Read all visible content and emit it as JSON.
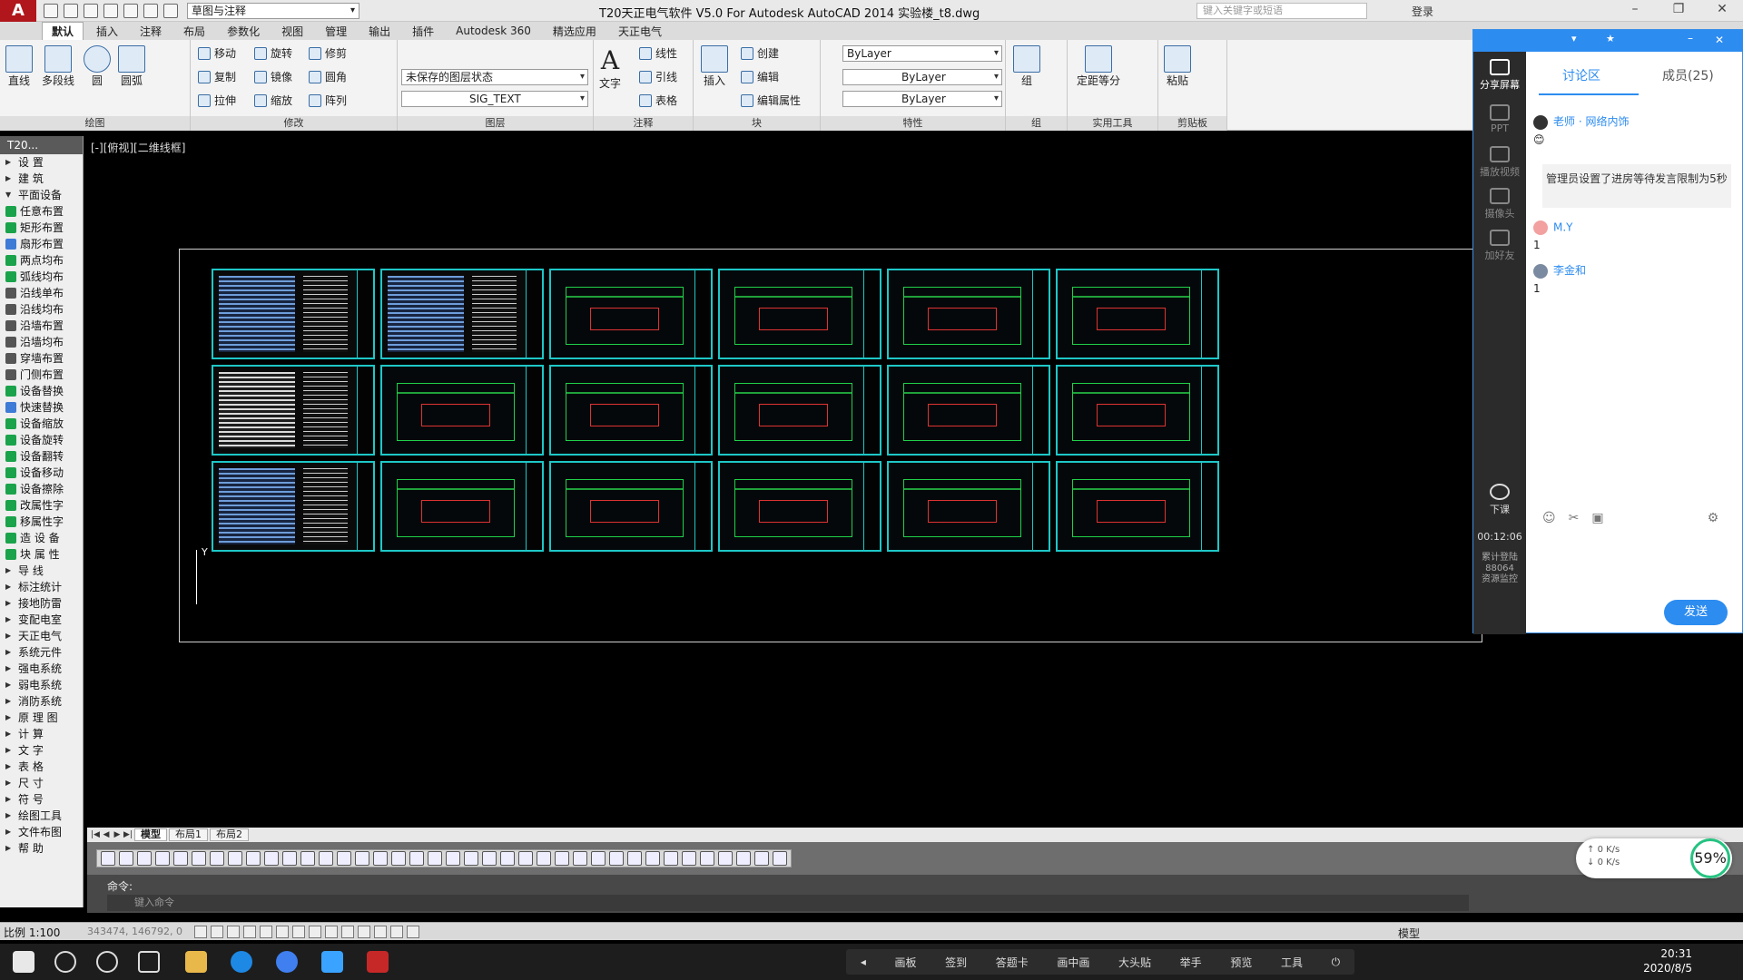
{
  "titlebar": {
    "workspace": "草图与注释",
    "title": "T20天正电气软件 V5.0 For Autodesk AutoCAD 2014    实验楼_t8.dwg",
    "search_placeholder": "键入关键字或短语",
    "login": "登录"
  },
  "ribbon": {
    "tabs": [
      "默认",
      "插入",
      "注释",
      "布局",
      "参数化",
      "视图",
      "管理",
      "输出",
      "插件",
      "Autodesk 360",
      "精选应用",
      "天正电气"
    ],
    "draw": {
      "title": "绘图",
      "line": "直线",
      "polyline": "多段线",
      "circle": "圆",
      "arc": "圆弧"
    },
    "modify": {
      "title": "修改",
      "move": "移动",
      "rotate": "旋转",
      "trim": "修剪",
      "copy": "复制",
      "mirror": "镜像",
      "fillet": "圆角",
      "stretch": "拉伸",
      "scale": "缩放",
      "array": "阵列"
    },
    "layers": {
      "title": "图层",
      "state": "未保存的图层状态",
      "current": "SIG_TEXT"
    },
    "annotation": {
      "title": "注释",
      "text": "文字",
      "linear": "线性",
      "leader": "引线",
      "table": "表格"
    },
    "block": {
      "title": "块",
      "insert": "插入",
      "create": "创建",
      "edit": "编辑",
      "attr": "编辑属性"
    },
    "properties": {
      "title": "特性",
      "color": "ByLayer",
      "linetype": "ByLayer",
      "lineweight": "ByLayer"
    },
    "group": {
      "title": "组",
      "group": "组"
    },
    "utilities": {
      "title": "实用工具",
      "measure": "定距等分"
    },
    "clipboard": {
      "title": "剪贴板",
      "paste": "粘贴"
    }
  },
  "t20": {
    "header": "T20...",
    "items": [
      {
        "label": "设    置",
        "type": "cat"
      },
      {
        "label": "建    筑",
        "type": "cat"
      },
      {
        "label": "平面设备",
        "type": "cat",
        "open": true
      },
      {
        "label": "任意布置",
        "type": "tool",
        "color": "#1aa34a"
      },
      {
        "label": "矩形布置",
        "type": "tool",
        "color": "#1aa34a"
      },
      {
        "label": "扇形布置",
        "type": "tool",
        "color": "#3d7bd6"
      },
      {
        "label": "两点均布",
        "type": "tool",
        "color": "#1aa34a"
      },
      {
        "label": "弧线均布",
        "type": "tool",
        "color": "#1aa34a"
      },
      {
        "label": "沿线单布",
        "type": "tool",
        "color": "#555"
      },
      {
        "label": "沿线均布",
        "type": "tool",
        "color": "#555"
      },
      {
        "label": "沿墙布置",
        "type": "tool",
        "color": "#555"
      },
      {
        "label": "沿墙均布",
        "type": "tool",
        "color": "#555"
      },
      {
        "label": "穿墙布置",
        "type": "tool",
        "color": "#555"
      },
      {
        "label": "门侧布置",
        "type": "tool",
        "color": "#555"
      },
      {
        "label": "设备替换",
        "type": "tool",
        "color": "#1aa34a"
      },
      {
        "label": "快速替换",
        "type": "tool",
        "color": "#3d7bd6"
      },
      {
        "label": "设备缩放",
        "type": "tool",
        "color": "#1aa34a"
      },
      {
        "label": "设备旋转",
        "type": "tool",
        "color": "#1aa34a"
      },
      {
        "label": "设备翻转",
        "type": "tool",
        "color": "#1aa34a"
      },
      {
        "label": "设备移动",
        "type": "tool",
        "color": "#1aa34a"
      },
      {
        "label": "设备擦除",
        "type": "tool",
        "color": "#1aa34a"
      },
      {
        "label": "改属性字",
        "type": "tool",
        "color": "#1aa34a"
      },
      {
        "label": "移属性字",
        "type": "tool",
        "color": "#1aa34a"
      },
      {
        "label": "造 设 备",
        "type": "tool",
        "color": "#1aa34a"
      },
      {
        "label": "块 属 性",
        "type": "tool",
        "color": "#1aa34a"
      },
      {
        "label": "导    线",
        "type": "cat"
      },
      {
        "label": "标注统计",
        "type": "cat"
      },
      {
        "label": "接地防雷",
        "type": "cat"
      },
      {
        "label": "变配电室",
        "type": "cat"
      },
      {
        "label": "天正电气",
        "type": "cat"
      },
      {
        "label": "系统元件",
        "type": "cat"
      },
      {
        "label": "强电系统",
        "type": "cat"
      },
      {
        "label": "弱电系统",
        "type": "cat"
      },
      {
        "label": "消防系统",
        "type": "cat"
      },
      {
        "label": "原 理 图",
        "type": "cat"
      },
      {
        "label": "计    算",
        "type": "cat"
      },
      {
        "label": "文    字",
        "type": "cat"
      },
      {
        "label": "表    格",
        "type": "cat"
      },
      {
        "label": "尺    寸",
        "type": "cat"
      },
      {
        "label": "符    号",
        "type": "cat"
      },
      {
        "label": "绘图工具",
        "type": "cat"
      },
      {
        "label": "文件布图",
        "type": "cat"
      },
      {
        "label": "帮    助",
        "type": "cat"
      }
    ]
  },
  "canvas": {
    "view_label": "[-][俯视][二维线框]",
    "ucs_label": "Y"
  },
  "layout_tabs": [
    "模型",
    "布局1",
    "布局2"
  ],
  "command": {
    "history": "命令:",
    "placeholder": "键入命令"
  },
  "status": {
    "scale": "比例 1:100",
    "coords": "343474, 146792, 0",
    "model": "模型"
  },
  "chat": {
    "tabs": [
      "讨论区",
      "成员(25)"
    ],
    "side": [
      {
        "label": "分享屏幕",
        "active": true
      },
      {
        "label": "PPT",
        "active": false
      },
      {
        "label": "播放视频",
        "active": false
      },
      {
        "label": "摄像头",
        "active": false
      },
      {
        "label": "加好友",
        "active": false
      }
    ],
    "messages": [
      {
        "name": "老师 · 网络内饰",
        "text": "😊",
        "avatar": "#333"
      },
      {
        "name": "M.Y",
        "text": "1",
        "avatar": "#f2a0a0"
      },
      {
        "name": "李金和",
        "text": "1",
        "avatar": "#7a8aa0"
      }
    ],
    "notice": "管理员设置了进房等待发言限制为5秒",
    "class_label": "下课",
    "timer": "00:12:06",
    "accum": "累计登陆",
    "accum_count": "88064",
    "monitor": "资源监控",
    "send": "发送"
  },
  "net": {
    "up": "0 K/s",
    "down": "0 K/s",
    "percent": "59%"
  },
  "taskbar": {
    "presenter": [
      "画板",
      "签到",
      "答题卡",
      "画中画",
      "大头贴",
      "举手",
      "预览",
      "工具"
    ],
    "time": "20:31",
    "date": "2020/8/5"
  }
}
